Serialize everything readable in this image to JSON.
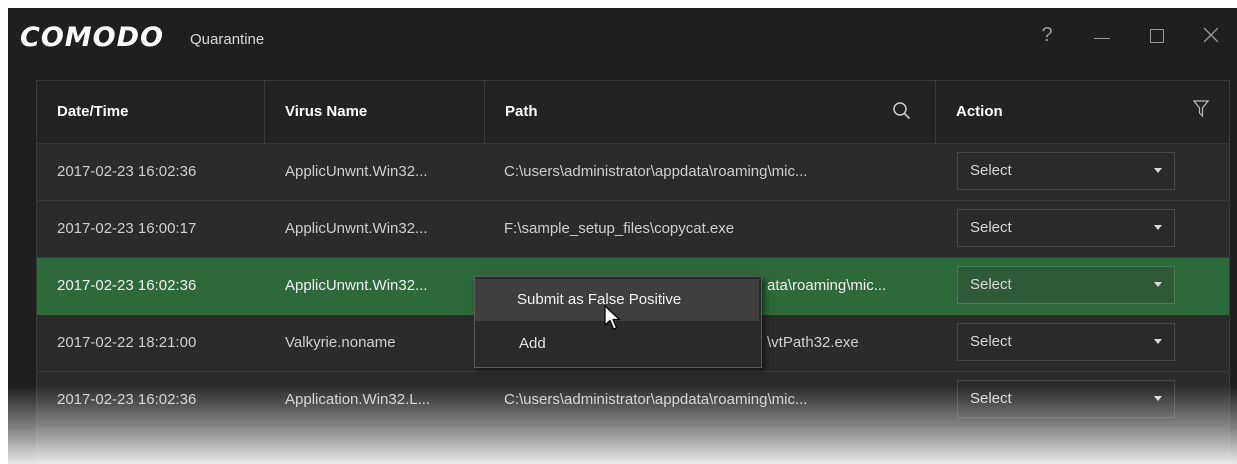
{
  "window": {
    "brand": "COMODO",
    "title": "Quarantine",
    "controls": {
      "help": "?",
      "minimize": "minimize",
      "maximize": "maximize",
      "close": "close"
    }
  },
  "table": {
    "columns": [
      {
        "label": "Date/Time"
      },
      {
        "label": "Virus Name"
      },
      {
        "label": "Path",
        "icon": "search-icon"
      },
      {
        "label": "Action",
        "icon": "filter-icon"
      }
    ],
    "rows": [
      {
        "date": "2017-02-23 16:02:36",
        "virus": "ApplicUnwnt.Win32...",
        "path": "C:\\users\\administrator\\appdata\\roaming\\mic...",
        "action": "Select",
        "selected": false
      },
      {
        "date": "2017-02-23 16:00:17",
        "virus": "ApplicUnwnt.Win32...",
        "path": "F:\\sample_setup_files\\copycat.exe",
        "action": "Select",
        "selected": false
      },
      {
        "date": "2017-02-23 16:02:36",
        "virus": "ApplicUnwnt.Win32...",
        "path": "ata\\roaming\\mic...",
        "action": "Select",
        "selected": true
      },
      {
        "date": "2017-02-22 18:21:00",
        "virus": "Valkyrie.noname",
        "path": "\\vtPath32.exe",
        "action": "Select",
        "selected": false
      },
      {
        "date": "2017-02-23 16:02:36",
        "virus": "Application.Win32.L...",
        "path": "C:\\users\\administrator\\appdata\\roaming\\mic...",
        "action": "Select",
        "selected": false
      }
    ]
  },
  "context_menu": {
    "items": [
      {
        "label": "Submit as False Positive",
        "hover": true
      },
      {
        "label": "Add",
        "hover": false
      }
    ]
  },
  "colors": {
    "window_bg": "#1f1f1f",
    "panel_bg": "#2b2b2b",
    "selected_row": "#2d6a3a"
  }
}
